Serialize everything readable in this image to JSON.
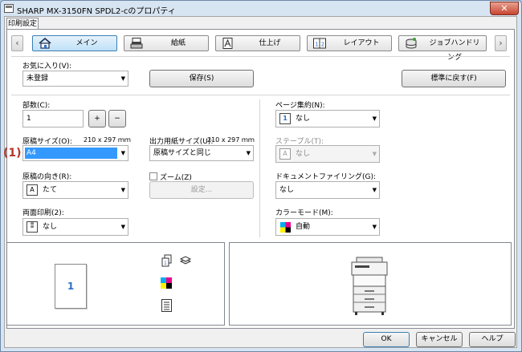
{
  "window": {
    "title": "SHARP MX-3150FN SPDL2-cのプロパティ",
    "close_label": "✕"
  },
  "tabs": [
    {
      "label": "印刷設定"
    }
  ],
  "nav": {
    "prev_label": "‹",
    "next_label": "›",
    "items": [
      {
        "label": "メイン",
        "icon": "home-icon"
      },
      {
        "label": "給紙",
        "icon": "paper-tray-icon"
      },
      {
        "label": "仕上げ",
        "icon": "finishing-icon"
      },
      {
        "label": "レイアウト",
        "icon": "layout-icon"
      },
      {
        "label": "ジョブハンドリング",
        "icon": "job-handling-icon"
      }
    ]
  },
  "favorites": {
    "label": "お気に入り(V):",
    "value": "未登録",
    "save_label": "保存(S)",
    "reset_label": "標準に戻す(F)"
  },
  "copies": {
    "label": "部数(C):",
    "value": "1",
    "plus": "+",
    "minus": "−"
  },
  "original_size": {
    "label": "原稿サイズ(O):",
    "dims": "210 x 297 ｍｍ",
    "value": "A4",
    "marker": "(1)"
  },
  "output_size": {
    "label": "出力用紙サイズ(U):",
    "dims": "210 x 297 ｍｍ",
    "value": "原稿サイズと同じ"
  },
  "orientation": {
    "label": "原稿の向き(R):",
    "value": "たて"
  },
  "zoom": {
    "label": "ズーム(Z)",
    "settings_label": "設定..."
  },
  "duplex": {
    "label": "両面印刷(2):",
    "value": "なし"
  },
  "n_up": {
    "label": "ページ集約(N):",
    "value": "なし"
  },
  "staple": {
    "label": "ステープル(T):",
    "value": "なし"
  },
  "filing": {
    "label": "ドキュメントファイリング(G):",
    "value": "なし"
  },
  "color": {
    "label": "カラーモード(M):",
    "value": "自動"
  },
  "preview": {
    "page_number": "1"
  },
  "footer": {
    "ok": "OK",
    "cancel": "キャンセル",
    "help": "ヘルプ"
  }
}
